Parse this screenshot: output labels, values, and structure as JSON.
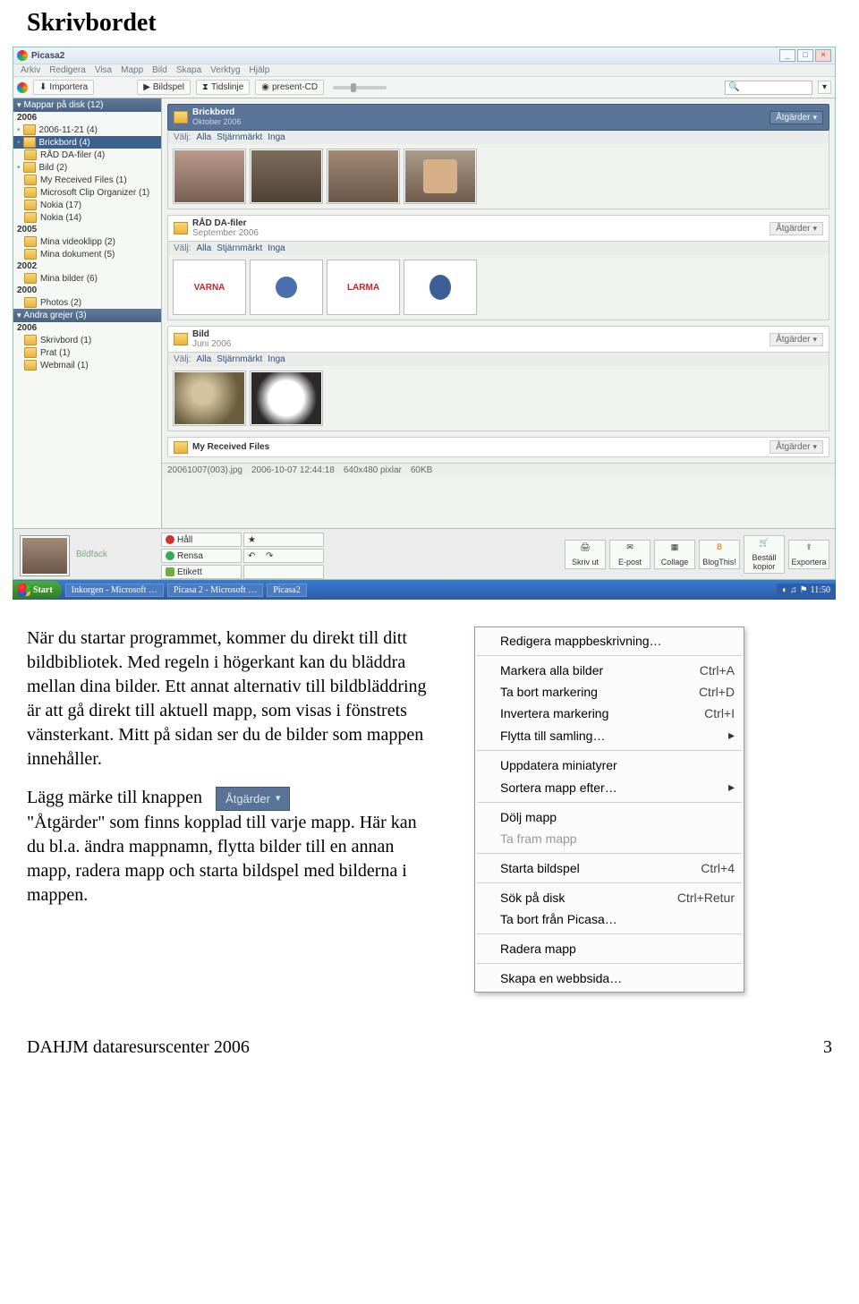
{
  "page_title": "Skrivbordet",
  "picasa": {
    "title": "Picasa2",
    "menus": [
      "Arkiv",
      "Redigera",
      "Visa",
      "Mapp",
      "Bild",
      "Skapa",
      "Verktyg",
      "Hjälp"
    ],
    "toolbar": {
      "importera": "Importera",
      "bildspel": "Bildspel",
      "tidslinje": "Tidslinje",
      "presentcd": "present-CD"
    },
    "sidebar": {
      "folders_header": "Mappar på disk (12)",
      "years": [
        {
          "year": "2006",
          "items": [
            {
              "label": "2006-11-21 (4)",
              "dot": true
            },
            {
              "label": "Brickbord (4)",
              "dot": true,
              "selected": true
            },
            {
              "label": "RÅD DA-filer (4)",
              "dot": false
            },
            {
              "label": "Bild (2)",
              "dot": true
            },
            {
              "label": "My Received Files (1)",
              "dot": false
            },
            {
              "label": "Microsoft Clip Organizer (1)",
              "dot": false
            },
            {
              "label": "Nokia (17)",
              "dot": false
            },
            {
              "label": "Nokia (14)",
              "dot": false
            }
          ]
        },
        {
          "year": "2005",
          "items": [
            {
              "label": "Mina videoklipp (2)",
              "dot": false
            },
            {
              "label": "Mina dokument (5)",
              "dot": false
            }
          ]
        },
        {
          "year": "2002",
          "items": [
            {
              "label": "Mina bilder (6)",
              "dot": false
            }
          ]
        },
        {
          "year": "2000",
          "items": [
            {
              "label": "Photos (2)",
              "dot": false
            }
          ]
        }
      ],
      "other_header": "Andra grejer (3)",
      "other_year": "2006",
      "other_items": [
        {
          "label": "Skrivbord (1)",
          "dot": false
        },
        {
          "label": "Prat (1)",
          "dot": false
        },
        {
          "label": "Webmail (1)",
          "dot": false
        }
      ]
    },
    "albums": [
      {
        "title": "Brickbord",
        "sub": "Oktober 2006",
        "actions": "Åtgärder",
        "select": {
          "label": "Välj:",
          "alla": "Alla",
          "st": "Stjärnmärkt",
          "inga": "Inga"
        }
      },
      {
        "title": "RÅD DA-filer",
        "sub": "September 2006",
        "actions": "Åtgärder",
        "select": {
          "label": "Välj:",
          "alla": "Alla",
          "st": "Stjärnmärkt",
          "inga": "Inga"
        }
      },
      {
        "title": "Bild",
        "sub": "Juni 2006",
        "actions": "Åtgärder",
        "select": {
          "label": "Välj:",
          "alla": "Alla",
          "st": "Stjärnmärkt",
          "inga": "Inga"
        }
      },
      {
        "title": "My Received Files",
        "sub": "",
        "actions": "Åtgärder"
      }
    ],
    "varna": "VARNA",
    "larma": "LARMA",
    "status": {
      "file": "20061007(003).jpg",
      "date": "2006-10-07 12:44:18",
      "dim": "640x480 pixlar",
      "size": "60KB"
    },
    "bottom": {
      "tray_label": "Bildfack",
      "hall": "Håll",
      "rensa": "Rensa",
      "etikett": "Etikett",
      "star": "★",
      "rotl": "↶",
      "rotr": "↷"
    },
    "export": {
      "skriv": "Skriv ut",
      "epost": "E-post",
      "collage": "Collage",
      "blog": "BlogThis!",
      "bestall": "Beställ kopior",
      "exportera": "Exportera"
    }
  },
  "taskbar": {
    "start": "Start",
    "tasks": [
      "Inkorgen - Microsoft …",
      "Picasa 2 - Microsoft …",
      "Picasa2"
    ],
    "clock": "11:50"
  },
  "body_text": {
    "p1": "När du startar programmet, kommer du direkt till ditt bildbibliotek. Med regeln i högerkant kan du bläddra mellan dina bilder. Ett annat alternativ till bildbläddring är att gå direkt till aktuell mapp, som visas i fönstrets vänsterkant. Mitt på sidan ser du de bilder som mappen innehåller.",
    "p2a": "Lägg märke till knappen",
    "p2b": "\"Åtgärder\" som finns kopplad till varje mapp. Här kan du bl.a. ändra mappnamn, flytta bilder till en annan mapp, radera mapp och starta bildspel med bilderna i mappen.",
    "pill": "Åtgärder"
  },
  "menu": {
    "items": [
      {
        "label": "Redigera mappbeskrivning…",
        "type": "item"
      },
      {
        "type": "sep"
      },
      {
        "label": "Markera alla bilder",
        "shortcut": "Ctrl+A",
        "type": "sc"
      },
      {
        "label": "Ta bort markering",
        "shortcut": "Ctrl+D",
        "type": "sc"
      },
      {
        "label": "Invertera markering",
        "shortcut": "Ctrl+I",
        "type": "sc"
      },
      {
        "label": "Flytta till samling…",
        "type": "sub"
      },
      {
        "type": "sep"
      },
      {
        "label": "Uppdatera miniatyrer",
        "type": "item"
      },
      {
        "label": "Sortera mapp efter…",
        "type": "sub"
      },
      {
        "type": "sep"
      },
      {
        "label": "Dölj mapp",
        "type": "item"
      },
      {
        "label": "Ta fram mapp",
        "type": "disabled"
      },
      {
        "type": "sep"
      },
      {
        "label": "Starta bildspel",
        "shortcut": "Ctrl+4",
        "type": "sc"
      },
      {
        "type": "sep"
      },
      {
        "label": "Sök på disk",
        "shortcut": "Ctrl+Retur",
        "type": "sc"
      },
      {
        "label": "Ta bort från Picasa…",
        "type": "item"
      },
      {
        "type": "sep"
      },
      {
        "label": "Radera mapp",
        "type": "item"
      },
      {
        "type": "sep"
      },
      {
        "label": "Skapa en webbsida…",
        "type": "item"
      }
    ]
  },
  "footer": {
    "left": "DAHJM dataresurscenter 2006",
    "right": "3"
  }
}
